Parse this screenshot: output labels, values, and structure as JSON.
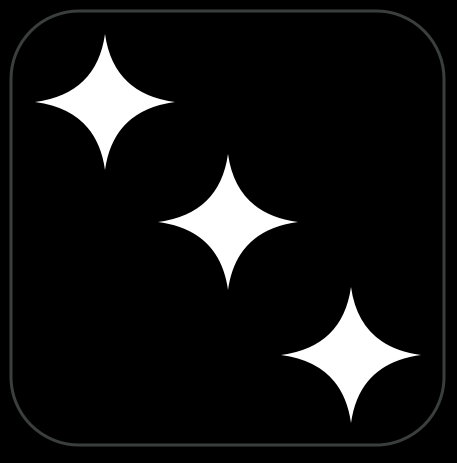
{
  "icon": {
    "name": "sparkles-icon",
    "sparkle_count": 3
  },
  "colors": {
    "background": "#000000",
    "tile_fill": "#000000",
    "tile_border": "#3a3f3d",
    "sparkle_fill": "#ffffff"
  }
}
